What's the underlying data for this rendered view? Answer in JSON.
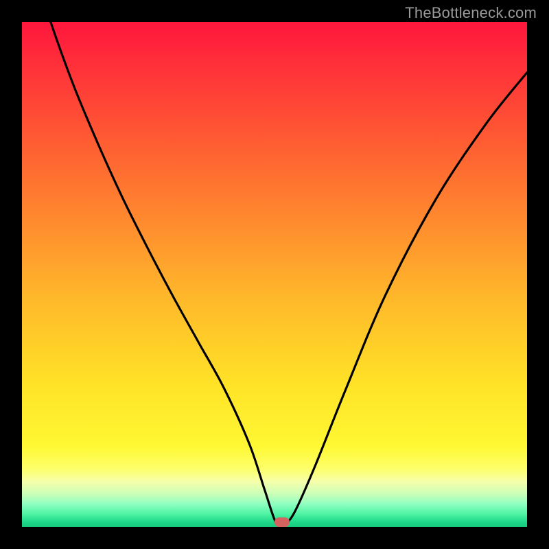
{
  "watermark": {
    "text": "TheBottleneck.com"
  },
  "chart_data": {
    "type": "line",
    "title": "",
    "xlabel": "",
    "ylabel": "",
    "xlim": [
      0,
      100
    ],
    "ylim": [
      0,
      100
    ],
    "grid": false,
    "background_gradient": {
      "top": "#ff163c",
      "mid_upper": "#ff8c2e",
      "mid": "#ffe327",
      "lower": "#c9ffb8",
      "bottom": "#16c97e"
    },
    "series": [
      {
        "name": "bottleneck-curve",
        "x": [
          0,
          5,
          10,
          15,
          20,
          25,
          30,
          35,
          40,
          45,
          48,
          50,
          51,
          52,
          54,
          58,
          64,
          72,
          82,
          92,
          100
        ],
        "y": [
          118,
          102,
          88,
          76,
          65,
          55,
          45.5,
          36.5,
          27.5,
          16.5,
          7.5,
          1.5,
          0.5,
          0.5,
          3,
          12,
          27,
          46,
          65,
          80,
          90
        ]
      }
    ],
    "marker": {
      "x": 51.5,
      "y": 0.9,
      "color": "#d4635f"
    }
  }
}
